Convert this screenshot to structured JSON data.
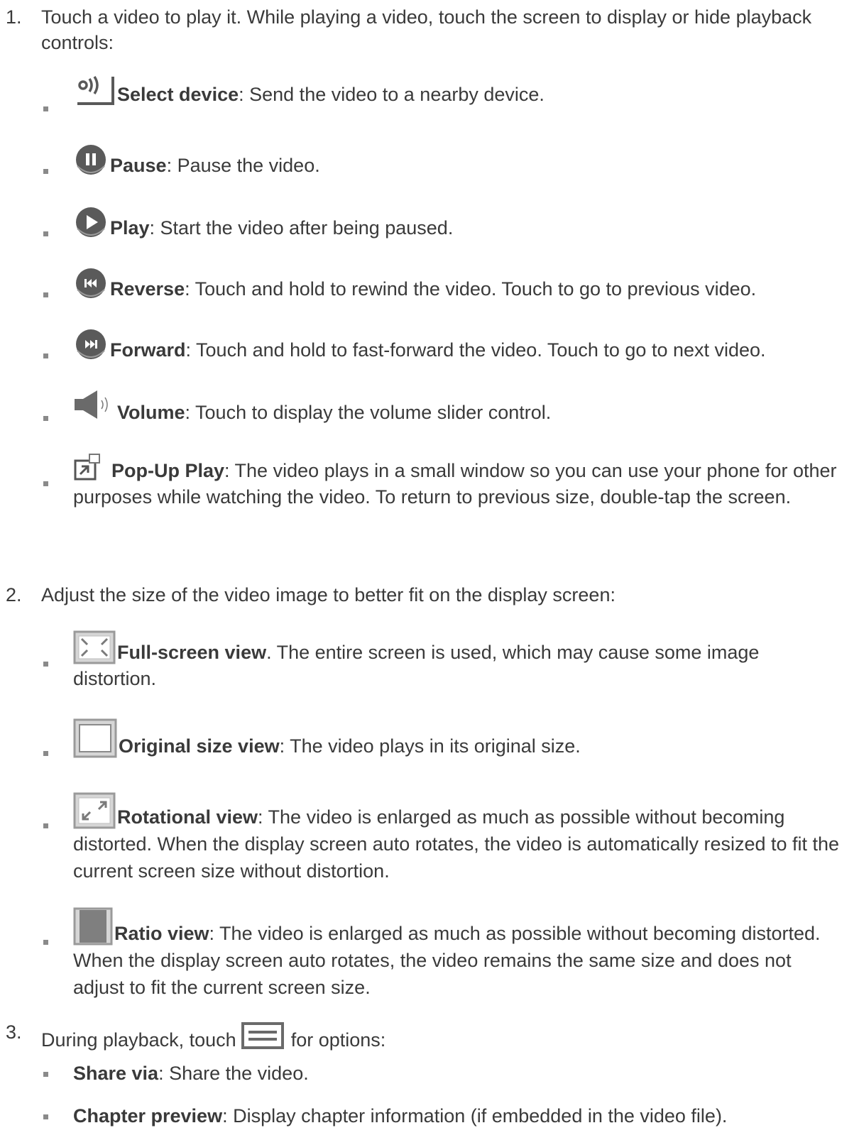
{
  "steps": [
    {
      "number": "1.",
      "text": "Touch a video to play it. While playing a video, touch the screen to display or hide playback controls:",
      "items": [
        {
          "icon": "cast-device-icon",
          "term": "Select device",
          "desc": ": Send the video to a nearby device."
        },
        {
          "icon": "pause-icon",
          "term": "Pause",
          "desc": ": Pause the video."
        },
        {
          "icon": "play-icon",
          "term": "Play",
          "desc": ": Start the video after being paused."
        },
        {
          "icon": "rewind-icon",
          "term": "Reverse",
          "desc": ": Touch and hold to rewind the video. Touch to go to previous video."
        },
        {
          "icon": "fast-forward-icon",
          "term": "Forward",
          "desc": ": Touch and hold to fast-forward the video. Touch to go to next video."
        },
        {
          "icon": "volume-icon",
          "term": "Volume",
          "desc": ": Touch to display the volume slider control."
        },
        {
          "icon": "popup-play-icon",
          "term": "Pop-Up Play",
          "desc": ": The video plays in a small window so you can use your phone for other purposes while watching the video. To return to previous size, double-tap the screen."
        }
      ]
    },
    {
      "number": "2.",
      "text": "Adjust the size of the video image to better fit on the display screen:",
      "items": [
        {
          "icon": "full-screen-view-icon",
          "term": "Full-screen view",
          "desc": ". The entire screen is used, which may cause some image distortion."
        },
        {
          "icon": "original-size-view-icon",
          "term": "Original size view",
          "desc": ": The video plays in its original size."
        },
        {
          "icon": "rotational-view-icon",
          "term": "Rotational view",
          "desc": ": The video is enlarged as much as possible without becoming distorted. When the display screen auto rotates, the video is automatically resized to fit the current screen size without distortion."
        },
        {
          "icon": "ratio-view-icon",
          "term": "Ratio view",
          "desc": ": The video is enlarged as much as possible without becoming distorted. When the display screen auto rotates, the video remains the same size and does not adjust to fit the current screen size."
        }
      ]
    },
    {
      "number": "3.",
      "text_before": "During playback, touch",
      "text_icon": "menu-icon",
      "text_after": "for options:",
      "items": [
        {
          "term": "Share via",
          "desc": ": Share the video."
        },
        {
          "term": "Chapter preview",
          "desc": ": Display chapter information (if embedded in the video file)."
        }
      ]
    }
  ],
  "colors": {
    "text": "#3a3a3a",
    "bullet": "#8a8a8a",
    "icon_dark": "#595959",
    "icon_gray": "#8c8c8c"
  }
}
